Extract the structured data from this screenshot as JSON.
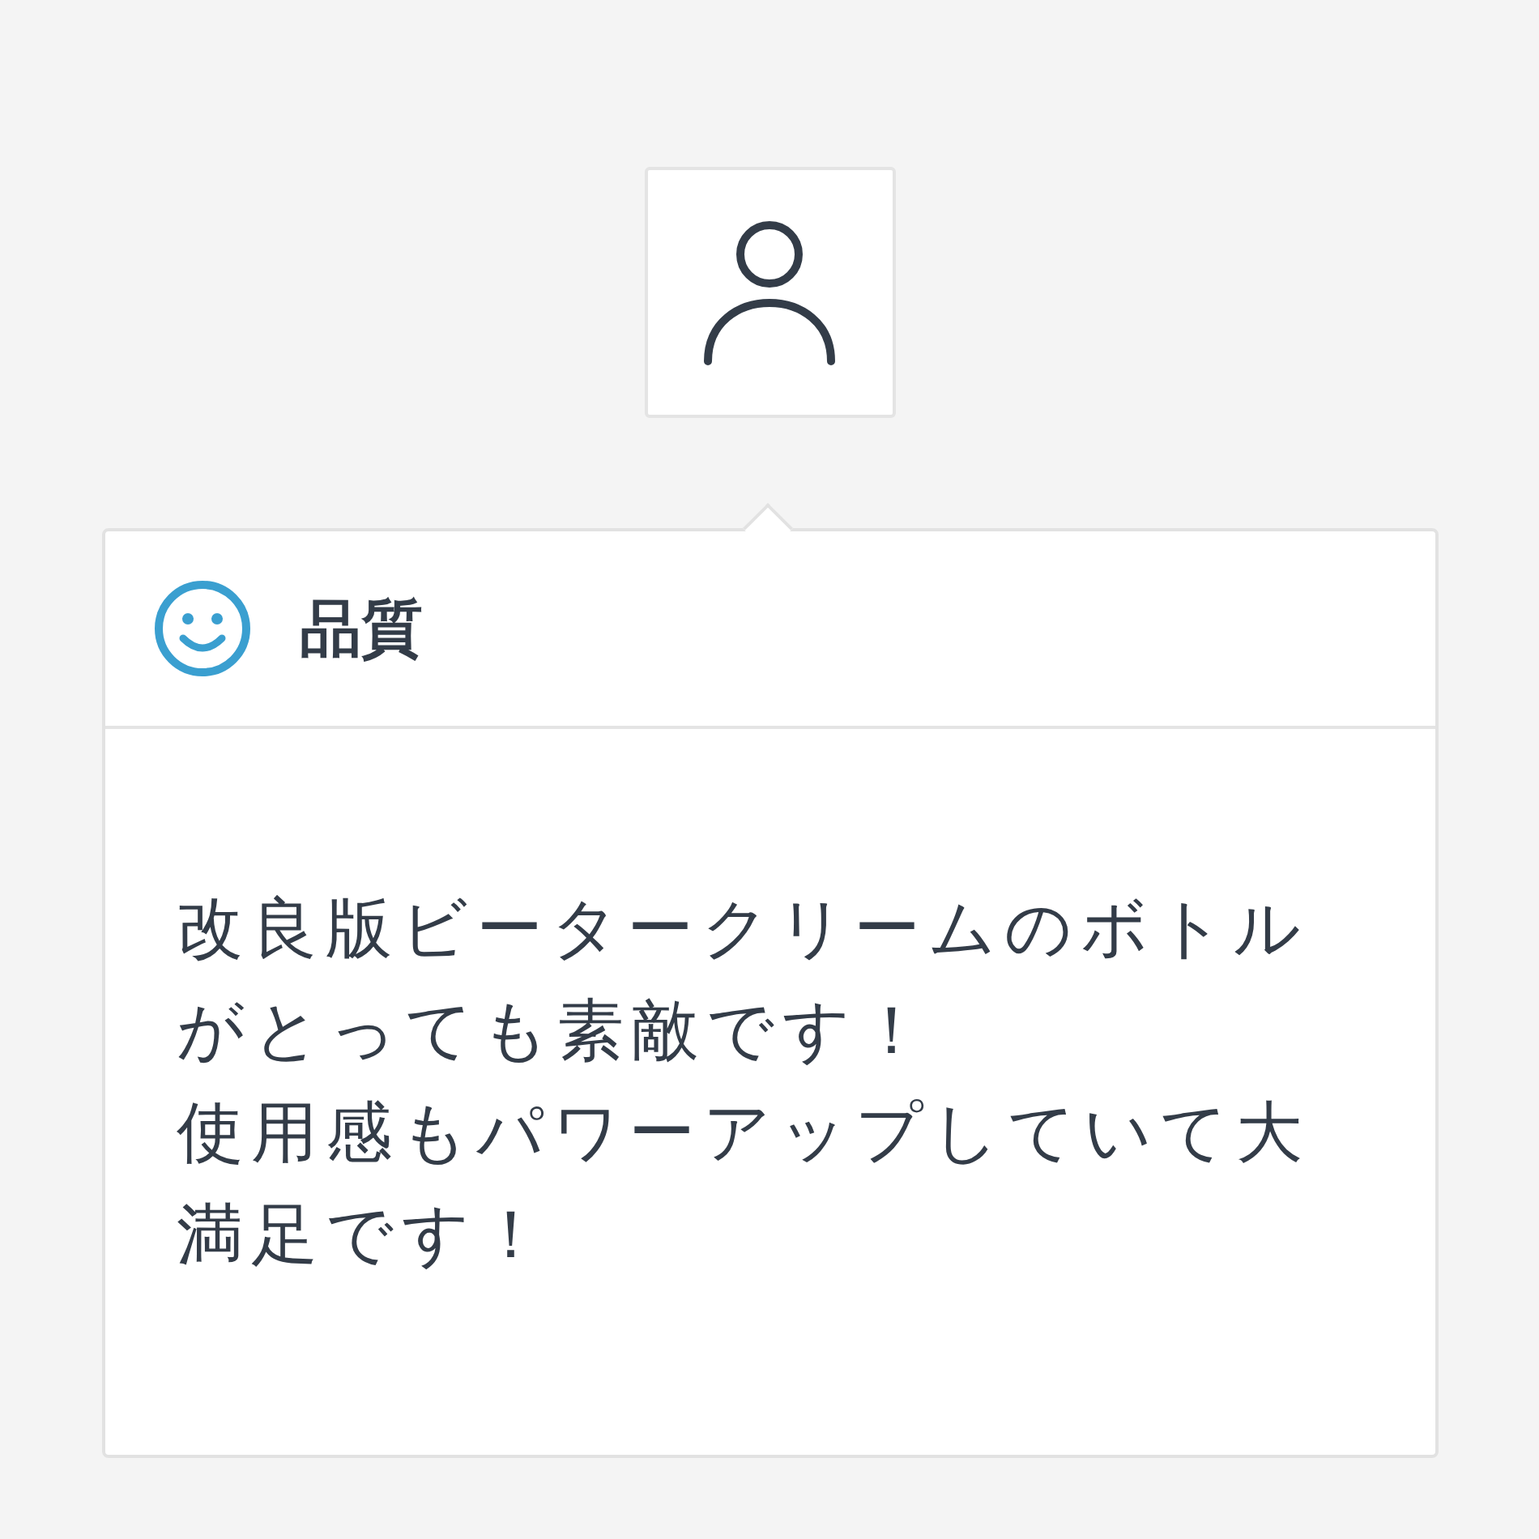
{
  "popover": {
    "title": "品質",
    "paragraphs": [
      "改良版ビータークリームのボトルがとっても素敵です！",
      "使用感もパワーアップしていて大満足です！"
    ]
  }
}
